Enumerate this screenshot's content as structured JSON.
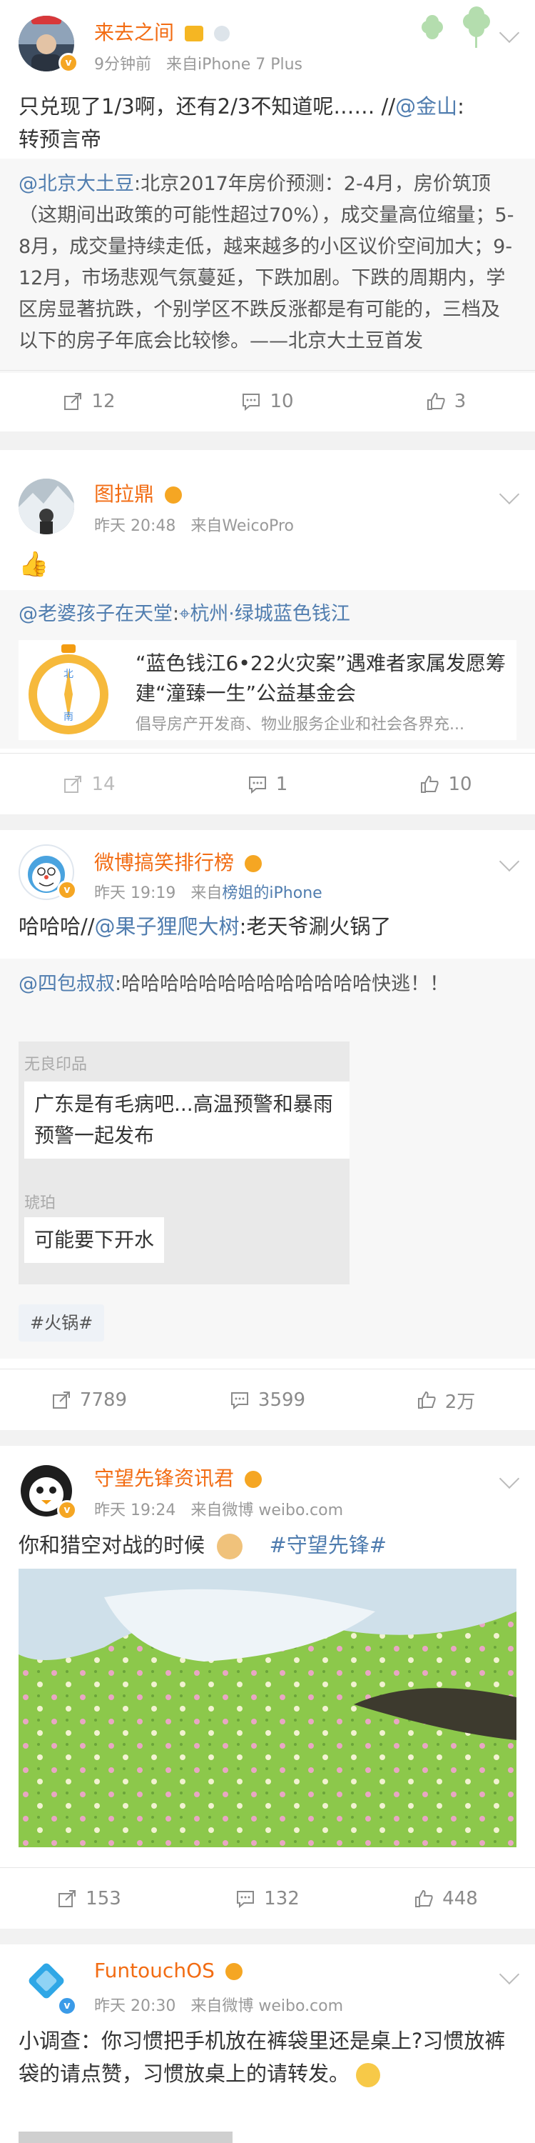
{
  "posts": [
    {
      "user": "来去之间",
      "time": "9分钟前",
      "source": "来自iPhone 7 Plus",
      "body_plain": "只兑现了1/3啊，还有2/3不知道呢…… //",
      "body_mention": "@金山",
      "body_end": ":",
      "body_line2": "转预言帝",
      "repost_mention": "@北京大土豆",
      "repost_text": ":北京2017年房价预测：2-4月，房价筑顶（这期间出政策的可能性超过70%），成交量高位缩量；5-8月，成交量持续走低，越来越多的小区议价空间加大；9-12月，市场悲观气氛蔓延，下跌加剧。下跌的周期内，学区房显著抗跌，个别学区不跌反涨都是有可能的，三档及以下的房子年底会比较惨。——北京大土豆首发",
      "reposts": "12",
      "comments": "10",
      "likes": "3"
    },
    {
      "user": "图拉鼎",
      "time": "昨天 20:48",
      "source": "来自WeicoPro",
      "repost_mention": "@老婆孩子在天堂",
      "repost_location": "杭州·绿城蓝色钱江",
      "card_title": "“蓝色钱江6•22火灾案”遇难者家属发愿筹建“潼臻一生”公益基金会",
      "card_desc": "倡导房产开发商、物业服务企业和社会各界充...",
      "compass_north": "北",
      "compass_south": "南",
      "reposts": "14",
      "comments": "1",
      "likes": "10"
    },
    {
      "user": "微博搞笑排行榜",
      "time": "昨天 19:19",
      "source_prefix": "来自",
      "source_link": "榜姐的iPhone",
      "body_plain": "哈哈哈//",
      "body_mention": "@果子狸爬大树",
      "body_end": ":老天爷涮火锅了",
      "repost_mention": "@四包叔叔",
      "repost_text": ":哈哈哈哈哈哈哈哈哈哈哈哈哈快逃！！",
      "img_label1": "无良印品",
      "img_text1": "广东是有毛病吧...高温预警和暴雨预警一起发布",
      "img_label2": "琥珀",
      "img_text2": "可能要下开水",
      "tag": "#火锅#",
      "reposts": "7789",
      "comments": "3599",
      "likes": "2万"
    },
    {
      "user": "守望先锋资讯君",
      "time": "昨天 19:24",
      "source": "来自微博 weibo.com",
      "body_plain": "你和猎空对战的时候",
      "body_tag": "#守望先锋#",
      "reposts": "153",
      "comments": "132",
      "likes": "448"
    },
    {
      "user": "FuntouchOS",
      "time": "昨天 20:30",
      "source": "来自微博 weibo.com",
      "body_plain": "小调查：你习惯把手机放在裤袋里还是桌上?习惯放裤袋的请点赞，习惯放桌上的请转发。"
    }
  ],
  "colors": {
    "accent": "#f26c13",
    "link": "#507daf",
    "vip": "#f5a623"
  }
}
